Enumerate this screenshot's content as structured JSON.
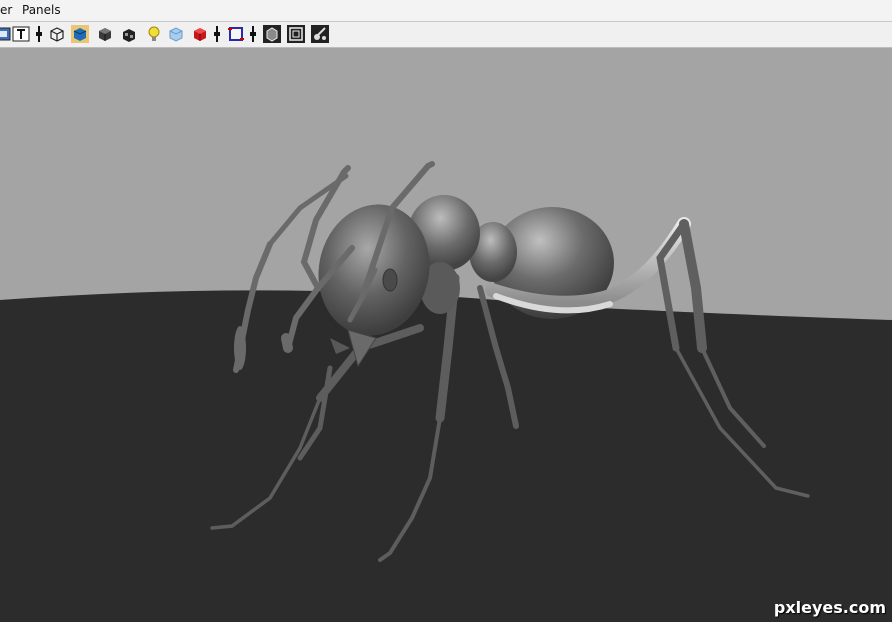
{
  "menu": {
    "items": [
      "er",
      "Panels"
    ]
  },
  "toolbar": {
    "icons": [
      "select-camera-icon",
      "text-icon",
      "wireframe-icon",
      "smooth-shade-icon",
      "shaded-cube-icon",
      "textured-cube-icon",
      "light-bulb-icon",
      "xray-cube-icon",
      "red-cube-icon",
      "isolate-frame-icon",
      "display-cube-icon",
      "resolution-gate-icon",
      "camera-attributes-icon"
    ]
  },
  "watermark": {
    "text": "pxleyes.com"
  },
  "colors": {
    "background_upper": "#a4a4a4",
    "ground": "#2c2c2c",
    "model_gray": "#6f6f6f"
  }
}
